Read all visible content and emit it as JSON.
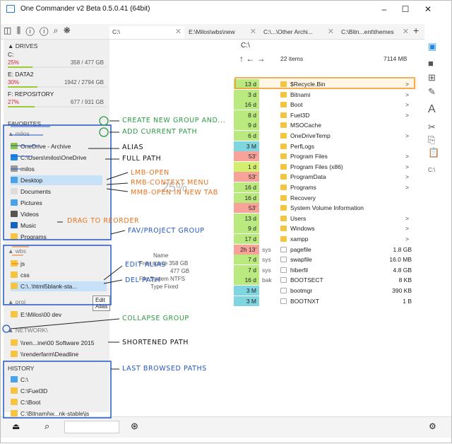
{
  "window": {
    "title": "One Commander v2 Beta 0.5.0.41 (64bit)",
    "icon": "app-icon",
    "min": "–",
    "max": "☐",
    "close": "✕"
  },
  "toolbar": {
    "icons": "◫ ⫼ ⓘ ⓘ ⌕ ❋"
  },
  "tabs": [
    {
      "label": "C:\\"
    },
    {
      "label": "E:\\Milos\\wbs\\new"
    },
    {
      "label": "C:\\...\\Other Archi..."
    },
    {
      "label": "C:\\Bitn...ent\\themes"
    }
  ],
  "addtab": "+",
  "left": {
    "drives_header": "DRIVES",
    "drives": [
      {
        "name": "C:",
        "pct": "25%",
        "size": "358 / 477 GB",
        "fill": 0.25
      },
      {
        "name": "E: DATA2",
        "pct": "30%",
        "size": "1942 / 2794 GB",
        "fill": 0.3
      },
      {
        "name": "F: REPOSITORY",
        "pct": "27%",
        "size": "677 / 931 GB",
        "fill": 0.27
      }
    ],
    "favorites_header": "FAVORITES",
    "milos_group": "milos",
    "favs": [
      "OneDrive - Archive",
      "C:\\Users\\milos\\OneDrive",
      "milos",
      "Desktop",
      "Documents",
      "Pictures",
      "Videos",
      "Music",
      "Programs"
    ],
    "wbs_group": "wbs",
    "wbs": [
      "js",
      "css",
      "C:\\..\\html5blank-sta..."
    ],
    "tooltip": "Edit Alias",
    "proj_group": "proj",
    "proj": [
      "E:\\Milos\\00 dev"
    ],
    "network_group": "NETWORK\\",
    "network": [
      "\\\\ren...ine\\00 Software 2015",
      "\\\\renderfarm\\Deadline"
    ],
    "history_header": "HISTORY",
    "history": [
      "C:\\",
      "C:\\Fuel3D",
      "C:\\Boot",
      "C:\\Bitnami\\w...nk-stable\\js"
    ]
  },
  "center": {
    "name": "Name",
    "free": "Free space",
    "free_val": "358 GB",
    "total_val": "477 GB",
    "fs": "File System",
    "fs_val": "NTFS",
    "type": "Type",
    "type_val": "Fixed",
    "pct": "25%"
  },
  "right": {
    "path": "C:\\",
    "items": "22 items",
    "total": "7114 MB"
  },
  "files": [
    {
      "age": "13 d",
      "attr": "",
      "name": "$Recycle.Bin",
      "size": "",
      "arrow": ">",
      "c": "#b9e97f",
      "sel": true
    },
    {
      "age": "3 d",
      "attr": "",
      "name": "Bitnami",
      "size": "",
      "arrow": ">",
      "c": "#b9e97f"
    },
    {
      "age": "16 d",
      "attr": "",
      "name": "Boot",
      "size": "",
      "arrow": ">",
      "c": "#b9e97f"
    },
    {
      "age": "8 d",
      "attr": "",
      "name": "Fuel3D",
      "size": "",
      "arrow": ">",
      "c": "#b9e97f"
    },
    {
      "age": "9 d",
      "attr": "",
      "name": "MSOCache",
      "size": "",
      "arrow": "",
      "c": "#b9e97f"
    },
    {
      "age": "6 d",
      "attr": "",
      "name": "OneDriveTemp",
      "size": "",
      "arrow": ">",
      "c": "#b9e97f"
    },
    {
      "age": "3 M",
      "attr": "",
      "name": "PerfLogs",
      "size": "",
      "arrow": "",
      "c": "#7fd6e0"
    },
    {
      "age": "53'",
      "attr": "",
      "name": "Program Files",
      "size": "",
      "arrow": ">",
      "c": "#f7a39a"
    },
    {
      "age": "1 d",
      "attr": "",
      "name": "Program Files (x86)",
      "size": "",
      "arrow": ">",
      "c": "#d4ef6f"
    },
    {
      "age": "53'",
      "attr": "",
      "name": "ProgramData",
      "size": "",
      "arrow": ">",
      "c": "#f7a39a"
    },
    {
      "age": "16 d",
      "attr": "",
      "name": "Programs",
      "size": "",
      "arrow": ">",
      "c": "#b9e97f"
    },
    {
      "age": "16 d",
      "attr": "",
      "name": "Recovery",
      "size": "",
      "arrow": "",
      "c": "#b9e97f"
    },
    {
      "age": "53'",
      "attr": "",
      "name": "System Volume Information",
      "size": "",
      "arrow": "",
      "c": "#f7a39a"
    },
    {
      "age": "13 d",
      "attr": "",
      "name": "Users",
      "size": "",
      "arrow": ">",
      "c": "#b9e97f"
    },
    {
      "age": "9 d",
      "attr": "",
      "name": "Windows",
      "size": "",
      "arrow": ">",
      "c": "#b9e97f"
    },
    {
      "age": "17 d",
      "attr": "",
      "name": "xampp",
      "size": "",
      "arrow": ">",
      "c": "#b9e97f"
    },
    {
      "age": "2h 13'",
      "attr": "sys",
      "name": "pagefile",
      "size": "1.8 GB",
      "arrow": "",
      "c": "#f7a39a"
    },
    {
      "age": "7 d",
      "attr": "sys",
      "name": "swapfile",
      "size": "16.0 MB",
      "arrow": "",
      "c": "#b9e97f"
    },
    {
      "age": "7 d",
      "attr": "sys",
      "name": "hiberfil",
      "size": "4.8 GB",
      "arrow": "",
      "c": "#b9e97f"
    },
    {
      "age": "16 d",
      "attr": "bak",
      "name": "BOOTSECT",
      "size": "8 KB",
      "arrow": "",
      "c": "#b9e97f"
    },
    {
      "age": "3 M",
      "attr": "",
      "name": "bootmgr",
      "size": "390 KB",
      "arrow": "",
      "c": "#7fd6e0"
    },
    {
      "age": "3 M",
      "attr": "",
      "name": "BOOTNXT",
      "size": "1 B",
      "arrow": "",
      "c": "#7fd6e0"
    }
  ],
  "annotations": {
    "create": "CREATE NEW GROUP AND...",
    "addcur": "ADD CURRENT PATH",
    "alias": "ALIAS",
    "fullpath": "FULL PATH",
    "lmb": "LMB-OPEN",
    "rmb": "RMB-CONTEXT MENU",
    "mmb": "MMB-OPEN IN NEW TAB",
    "drag": "DRAG TO REORDER",
    "favgroup": "FAV/PROJECT GROUP",
    "editalias": "EDIT ALIAS",
    "delpath": "DEL PATH",
    "collapse": "COLLAPSE GROUP",
    "short": "SHORTENED PATH",
    "last": "LAST BROWSED PATHS"
  },
  "status": {
    "search_placeholder": ""
  }
}
